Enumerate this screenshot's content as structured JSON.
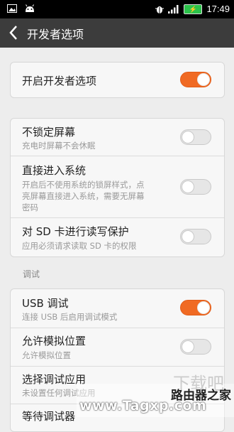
{
  "status": {
    "time": "17:49"
  },
  "title": "开发者选项",
  "master": {
    "label": "开启开发者选项",
    "on": true
  },
  "group1": [
    {
      "label": "不锁定屏幕",
      "sub": [
        "充电时屏幕不会休眠"
      ],
      "on": false
    },
    {
      "label": "直接进入系统",
      "sub": [
        "开启后不使用系统的锁屏样式，点",
        "亮屏幕直接进入系统，需要无屏幕",
        "密码"
      ],
      "on": false
    },
    {
      "label": "对 SD 卡进行读写保护",
      "sub": [
        "应用必须请求读取 SD 卡的权限"
      ],
      "on": false
    }
  ],
  "section_debug": "调试",
  "group2": [
    {
      "label": "USB 调试",
      "sub": [
        "连接 USB 后启用调试模式"
      ],
      "on": true
    },
    {
      "label": "允许模拟位置",
      "sub": [
        "允许模拟位置"
      ],
      "on": false
    },
    {
      "label": "选择调试应用",
      "sub": [
        "未设置任何调试应用"
      ]
    },
    {
      "label": "等待调试器"
    }
  ],
  "watermark": {
    "cn": "路由器之家",
    "url": "www.Tagxp.com",
    "big": "下载吧"
  }
}
